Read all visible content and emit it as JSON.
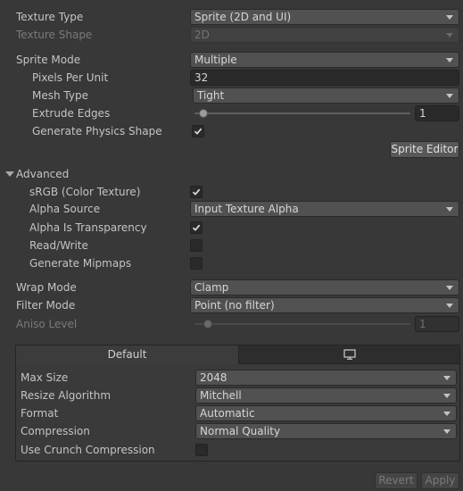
{
  "texture_type": {
    "label": "Texture Type",
    "value": "Sprite (2D and UI)"
  },
  "texture_shape": {
    "label": "Texture Shape",
    "value": "2D"
  },
  "sprite_mode": {
    "label": "Sprite Mode",
    "value": "Multiple"
  },
  "pixels_per_unit": {
    "label": "Pixels Per Unit",
    "value": "32"
  },
  "mesh_type": {
    "label": "Mesh Type",
    "value": "Tight"
  },
  "extrude_edges": {
    "label": "Extrude Edges",
    "value": "1",
    "level": 0.04
  },
  "generate_physics_shape": {
    "label": "Generate Physics Shape",
    "checked": true
  },
  "sprite_editor_button": "Sprite Editor",
  "advanced": {
    "label": "Advanced",
    "srgb": {
      "label": "sRGB (Color Texture)",
      "checked": true
    },
    "alpha_source": {
      "label": "Alpha Source",
      "value": "Input Texture Alpha"
    },
    "alpha_is_transparency": {
      "label": "Alpha Is Transparency",
      "checked": true
    },
    "read_write": {
      "label": "Read/Write",
      "checked": false
    },
    "generate_mipmaps": {
      "label": "Generate Mipmaps",
      "checked": false
    }
  },
  "wrap_mode": {
    "label": "Wrap Mode",
    "value": "Clamp"
  },
  "filter_mode": {
    "label": "Filter Mode",
    "value": "Point (no filter)"
  },
  "aniso_level": {
    "label": "Aniso Level",
    "value": "1",
    "level": 0.06
  },
  "platform_tabs": {
    "default_label": "Default",
    "second_tab_icon": "monitor-icon"
  },
  "platform": {
    "max_size": {
      "label": "Max Size",
      "value": "2048"
    },
    "resize_algorithm": {
      "label": "Resize Algorithm",
      "value": "Mitchell"
    },
    "format": {
      "label": "Format",
      "value": "Automatic"
    },
    "compression": {
      "label": "Compression",
      "value": "Normal Quality"
    },
    "use_crunch": {
      "label": "Use Crunch Compression",
      "checked": false
    }
  },
  "footer": {
    "revert_label": "Revert",
    "apply_label": "Apply"
  }
}
